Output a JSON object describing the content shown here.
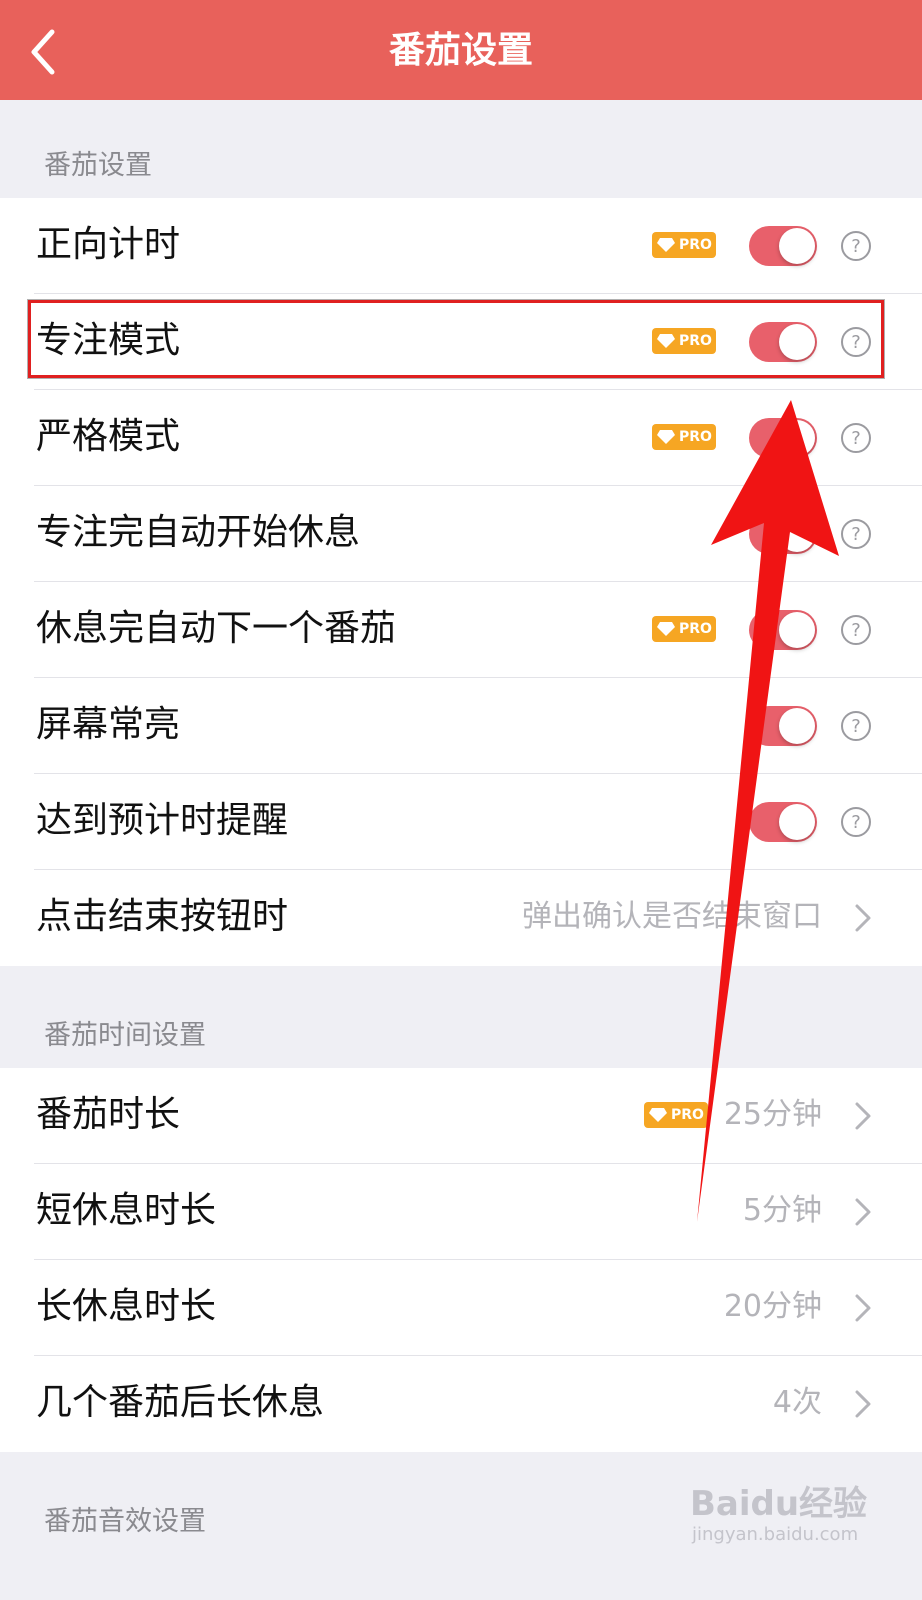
{
  "header": {
    "title": "番茄设置"
  },
  "sections": {
    "s1": "番茄设置",
    "s2": "番茄时间设置",
    "s3": "番茄音效设置"
  },
  "rows": {
    "r0": {
      "label": "正向计时",
      "pro": "PRO",
      "toggle": "on"
    },
    "r1": {
      "label": "专注模式",
      "pro": "PRO",
      "toggle": "on"
    },
    "r2": {
      "label": "严格模式",
      "pro": "PRO",
      "toggle": "on"
    },
    "r3": {
      "label": "专注完自动开始休息",
      "toggle": "on"
    },
    "r4": {
      "label": "休息完自动下一个番茄",
      "pro": "PRO",
      "toggle": "on"
    },
    "r5": {
      "label": "屏幕常亮",
      "toggle": "on"
    },
    "r6": {
      "label": "达到预计时提醒",
      "toggle": "on"
    },
    "r7": {
      "label": "点击结束按钮时",
      "value": "弹出确认是否结束窗口"
    },
    "t0": {
      "label": "番茄时长",
      "pro": "PRO",
      "value": "25分钟"
    },
    "t1": {
      "label": "短休息时长",
      "value": "5分钟"
    },
    "t2": {
      "label": "长休息时长",
      "value": "20分钟"
    },
    "t3": {
      "label": "几个番茄后长休息",
      "value": "4次"
    }
  },
  "watermark": {
    "logo": "Baidu经验",
    "url": "jingyan.baidu.com"
  },
  "colors": {
    "accent": "#e8615b",
    "toggle_on": "#e8606b",
    "pro_badge": "#f6a623",
    "annotation": "#e02020"
  }
}
